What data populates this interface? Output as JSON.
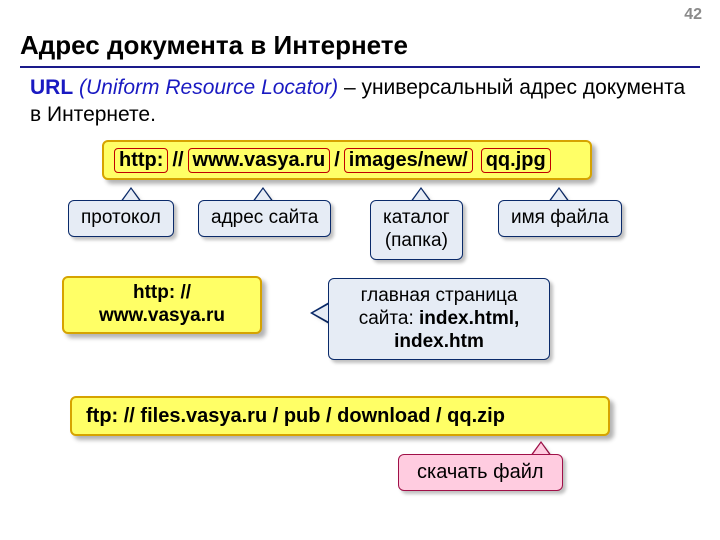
{
  "page_number": "42",
  "title": "Адрес документа в Интернете",
  "definition": {
    "url_label": "URL",
    "english": "(Uniform Resource Locator)",
    "rest": " – универсальный адрес документа в Интернете."
  },
  "urlparts": {
    "protocol": "http:",
    "sep1": "//",
    "host": "www.vasya.ru",
    "sep2": "/",
    "path": "images/new/",
    "file": "qq.jpg"
  },
  "labels": {
    "protocol": "протокол",
    "host": "адрес сайта",
    "path_l1": "каталог",
    "path_l2": "(папка)",
    "file": "имя файла"
  },
  "short_url_l1": "http: //",
  "short_url_l2": "www.vasya.ru",
  "homepage_l1": "главная страница",
  "homepage_l2_a": "сайта: ",
  "homepage_l2_b": "index.html,",
  "homepage_l3": "index.htm",
  "ftp_line": "ftp: // files.vasya.ru / pub / download / qq.zip",
  "download_label": "скачать файл"
}
